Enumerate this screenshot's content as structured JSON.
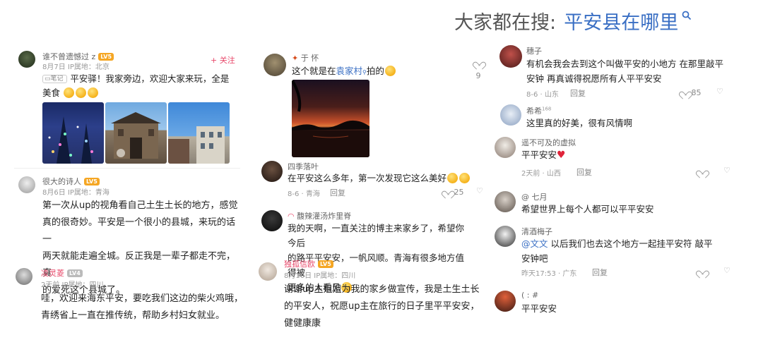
{
  "header": {
    "prefix": "大家都在搜:",
    "query": "平安县在哪里",
    "search_icon": "search-icon"
  },
  "left": {
    "post": {
      "author": "谁不曾遗憾过 z",
      "level": "LV5",
      "date_loc": "8月7日  IP属地：北京",
      "follow": "+ 关注",
      "tag": "笔记",
      "text1": "平安驿！我家旁边，欢迎大家来玩，全是",
      "text2": "美食"
    },
    "c1": {
      "author": "很大的诗人",
      "level": "LV5",
      "date_loc": "8月6日  IP属地：青海",
      "text1": "第一次从up的视角看自己土生土长的地方，感觉",
      "text2": "真的很奇妙。平安是一个很小的县城，来玩的话一",
      "text3": "两天就能走遍全城。反正我是一辈子都走不完，真",
      "text4": "的爱死这个县城了。"
    },
    "c2": {
      "author": "凌灵菱",
      "level": "LV4",
      "date_loc": "2天前  IP属地：四川",
      "text1": "哇，欢迎来海东平安，要吃我们这边的柴火鸡哦，",
      "text2": "青绣省上一直在推传统，帮助乡村妇女就业。"
    }
  },
  "middle": {
    "c1": {
      "author": "于  怀",
      "text_a": "这个就是在",
      "link": "袁家村",
      "text_b": "拍的",
      "likes": "9"
    },
    "c2": {
      "author": "四季落叶",
      "text": "在平安这么多年，第一次发现它这么美好",
      "date_loc": "8-6 · 青海",
      "reply": "回复",
      "likes": "25"
    },
    "c3": {
      "author": "馥辣灌汤炸里脊",
      "text1": "我的天啊，一直关注的博主来家乡了，希望你今后",
      "text2": "的路平平安安，一帆风顺。青海有很多地方值得被",
      "text3": "更多的人看见"
    },
    "c4": {
      "author": "独孤信欧",
      "level": "LV5",
      "date_loc": "8月10日  IP属地：四川",
      "text1": "谢谢up主姐姐为我的家乡做宣传，我是土生土长",
      "text2": "的平安人，祝愿up主在旅行的日子里平平安安，",
      "text3": "健健康康"
    }
  },
  "right": {
    "c1": {
      "author": "穗子",
      "text1": "有机会我会去到这个叫做平安的小地方 在那里敲平",
      "text2": "安钟 再真诚得祝愿所有人平平安安",
      "date_loc": "8-6 · 山东",
      "reply": "回复",
      "likes": "85"
    },
    "c2": {
      "author": "希希",
      "sup": "168",
      "text": "这里真的好美，很有风情啊"
    },
    "c3": {
      "author": "遥不可及的虚拟",
      "text": "平平安安",
      "date_loc": "2天前 · 山西",
      "reply": "回复"
    },
    "c4": {
      "author": "@ 七月",
      "text": "希望世界上每个人都可以平平安安"
    },
    "c5": {
      "author": "清酒梅子",
      "mention": "@文文",
      "text1": " 以后我们也去这个地方一起挂平安符 敲平",
      "text2": "安钟吧",
      "date_loc": "昨天17:53 · 广东",
      "reply": "回复"
    },
    "c6": {
      "author": "( :  #",
      "text": "平平安安"
    }
  }
}
